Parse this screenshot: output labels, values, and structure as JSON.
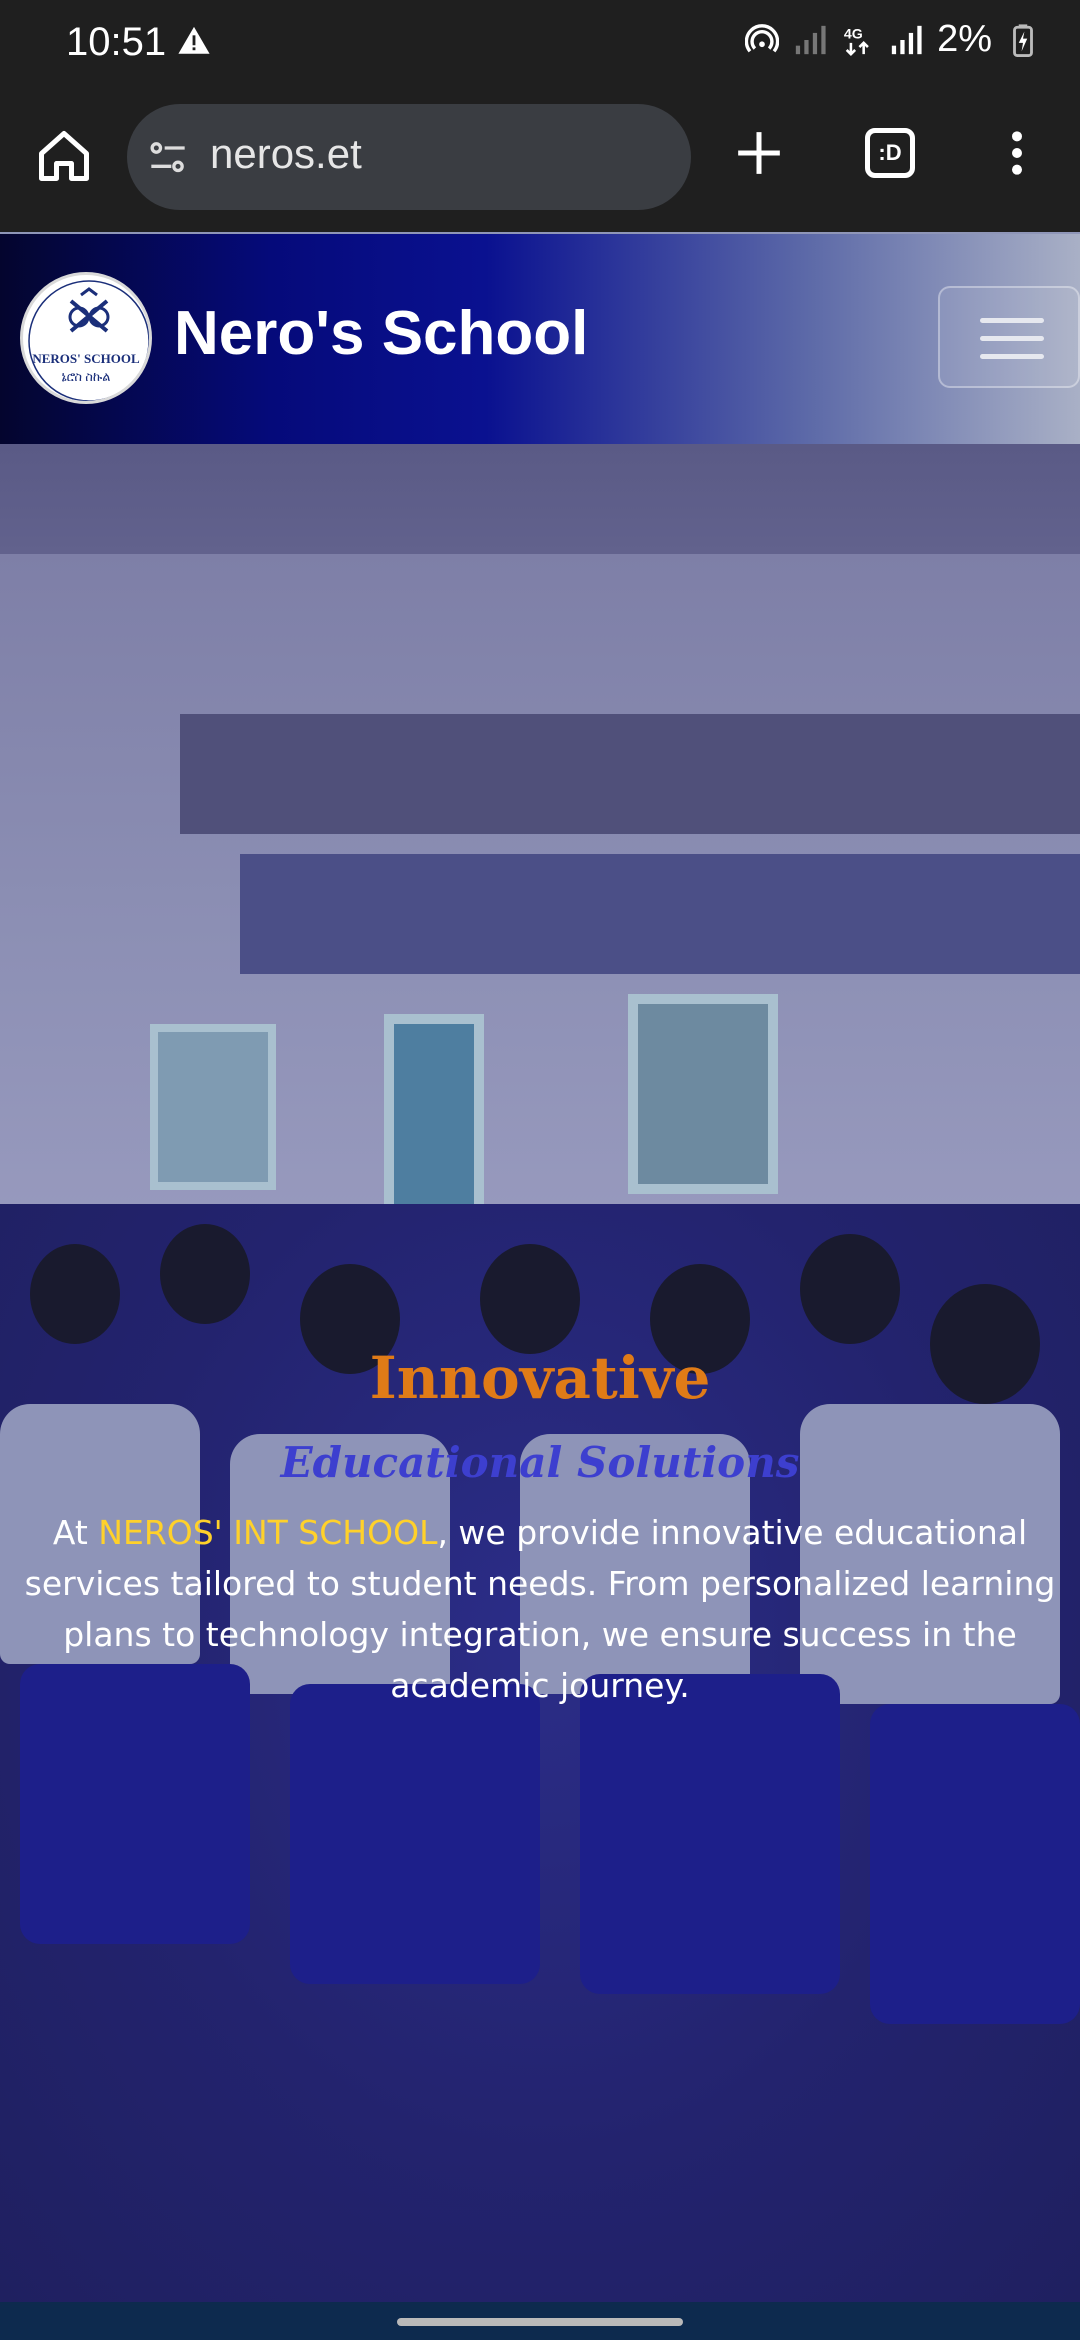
{
  "status_bar": {
    "time": "10:51",
    "battery_percent": "2%",
    "network": "4G",
    "icons": [
      "alert-icon",
      "hotspot-icon",
      "signal-icon",
      "4g-icon",
      "signal-icon",
      "battery-charging-icon"
    ]
  },
  "browser": {
    "url": "neros.et",
    "tab_icon_label": ":D",
    "icons": [
      "home-icon",
      "site-settings-icon",
      "plus-icon",
      "tab-switcher-icon",
      "more-vert-icon"
    ]
  },
  "header": {
    "logo_text_1": "NEROS' SCHOOL",
    "logo_text_2": "ኔሮስ ስኩል",
    "title": "Nero's School",
    "menu_icon": "hamburger-icon",
    "background_colors": [
      "#04052e",
      "#0a1190",
      "#a9b0c6"
    ]
  },
  "hero": {
    "title": "Innovative",
    "subtitle": "Educational Solutions",
    "text_prefix": "At ",
    "text_highlight": "NEROS' INT SCHOOL",
    "text_suffix": ", we provide innovative educational services tailored to student needs. From personalized learning plans to technology integration, we ensure success in the academic journey.",
    "colors": {
      "title": "#e07b17",
      "subtitle": "#3d3fcf",
      "highlight": "#ffd12a"
    }
  }
}
